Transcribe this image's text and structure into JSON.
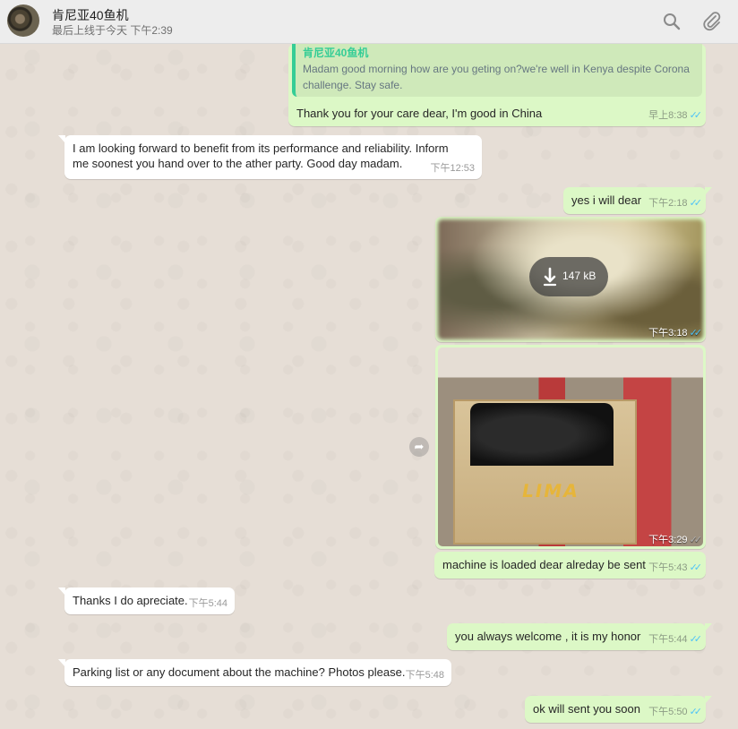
{
  "header": {
    "contact_name": "肯尼亚40鱼机",
    "last_seen": "最后上线于今天 下午2:39",
    "icons": [
      "search-icon",
      "attach-icon"
    ]
  },
  "messages": [
    {
      "direction": "out",
      "quote": {
        "author": "肯尼亚40鱼机",
        "text": "Madam good morning how are you geting on?we're well in Kenya despite Corona challenge. Stay safe."
      },
      "text": "Thank you for your care dear, I'm good in China",
      "time": "早上8:38"
    },
    {
      "direction": "in",
      "text": "I am looking forward to benefit from its performance and reliability. Inform me soonest you hand over to the ather party. Good day madam.",
      "time": "下午12:53"
    },
    {
      "direction": "out",
      "text": "yes i will dear",
      "time": "下午2:18"
    },
    {
      "direction": "out",
      "type": "image-download",
      "size": "147 kB",
      "time": "下午3:18"
    },
    {
      "direction": "out",
      "type": "image",
      "logo_text": "LIMA",
      "time": "下午3:29"
    },
    {
      "direction": "out",
      "text": "machine is loaded dear alreday be sent",
      "time": "下午5:43"
    },
    {
      "direction": "in",
      "text": "Thanks I do apreciate.",
      "time": "下午5:44"
    },
    {
      "direction": "out",
      "text": "you always welcome , it is  my honor",
      "time": "下午5:44"
    },
    {
      "direction": "in",
      "text": "Parking list or any document  about the machine? Photos please.",
      "time": "下午5:48"
    },
    {
      "direction": "out",
      "text": "ok will sent you soon",
      "time": "下午5:50"
    }
  ],
  "colors": {
    "chat_bg": "#e5ddd5",
    "outgoing_bubble": "#dcf8c6",
    "incoming_bubble": "#ffffff",
    "quote_accent": "#35cd96",
    "read_tick": "#4fc3f7"
  }
}
